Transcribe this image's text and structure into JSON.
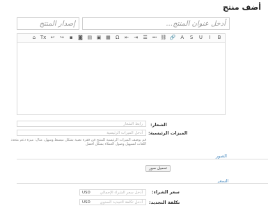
{
  "page": {
    "title": "أضف منتج"
  },
  "product": {
    "title_placeholder": "أدخل عنوان المنتج...",
    "version_placeholder": "إصدار المنتج"
  },
  "editor": {
    "toolbar": [
      {
        "name": "bold-icon",
        "glyph": "B"
      },
      {
        "name": "italic-icon",
        "glyph": "I"
      },
      {
        "name": "underline-icon",
        "glyph": "U"
      },
      {
        "name": "strikethrough-icon",
        "glyph": "S"
      },
      {
        "name": "font-color-icon",
        "glyph": "A"
      },
      {
        "name": "link-icon",
        "glyph": "🔗"
      },
      {
        "name": "unlink-icon",
        "glyph": "⛓"
      },
      {
        "name": "numbered-list-icon",
        "glyph": "≔"
      },
      {
        "name": "bulleted-list-icon",
        "glyph": "☰"
      },
      {
        "name": "indent-icon",
        "glyph": "⇥"
      },
      {
        "name": "outdent-icon",
        "glyph": "⇤"
      },
      {
        "name": "special-char-icon",
        "glyph": "Ω"
      },
      {
        "name": "table-icon",
        "glyph": "▦"
      },
      {
        "name": "image-icon",
        "glyph": "▣"
      },
      {
        "name": "media-icon",
        "glyph": "▤"
      },
      {
        "name": "camera-icon",
        "glyph": "◙"
      },
      {
        "name": "source-icon",
        "glyph": "▪"
      },
      {
        "name": "redo-icon",
        "glyph": "↪"
      },
      {
        "name": "undo-icon",
        "glyph": "↩"
      },
      {
        "name": "clear-format-icon",
        "glyph": "Tx"
      },
      {
        "name": "code-icon",
        "glyph": "⌂"
      }
    ]
  },
  "fields": {
    "logo": {
      "label": "الشعار:",
      "placeholder": "رابط الشعار"
    },
    "features": {
      "label": "الميزات الرئيسية:",
      "placeholder": "أدخل الميزات الرئيسية",
      "help": "قم بوصف الميزات الرئيسية للمنتج في فقرة نصية بشكل مبسط وسهل، مثال: ميزة دعم متعدد اللغات لتسهيل وصول العملاء بشكل أفضل"
    }
  },
  "sections": {
    "images": {
      "title": "الصور",
      "add_button": "تحميل صور"
    },
    "pricing": {
      "title": "السعر",
      "purchase_price": {
        "label": "سعر الشراء:",
        "placeholder": "أدخل سعر الشراء الإجمالي",
        "currency": "USD"
      },
      "renewal_cost": {
        "label": "تكلفة التجديد:",
        "placeholder": "أدخل تكلفة التجديد السنوي",
        "currency": "USD"
      }
    }
  }
}
